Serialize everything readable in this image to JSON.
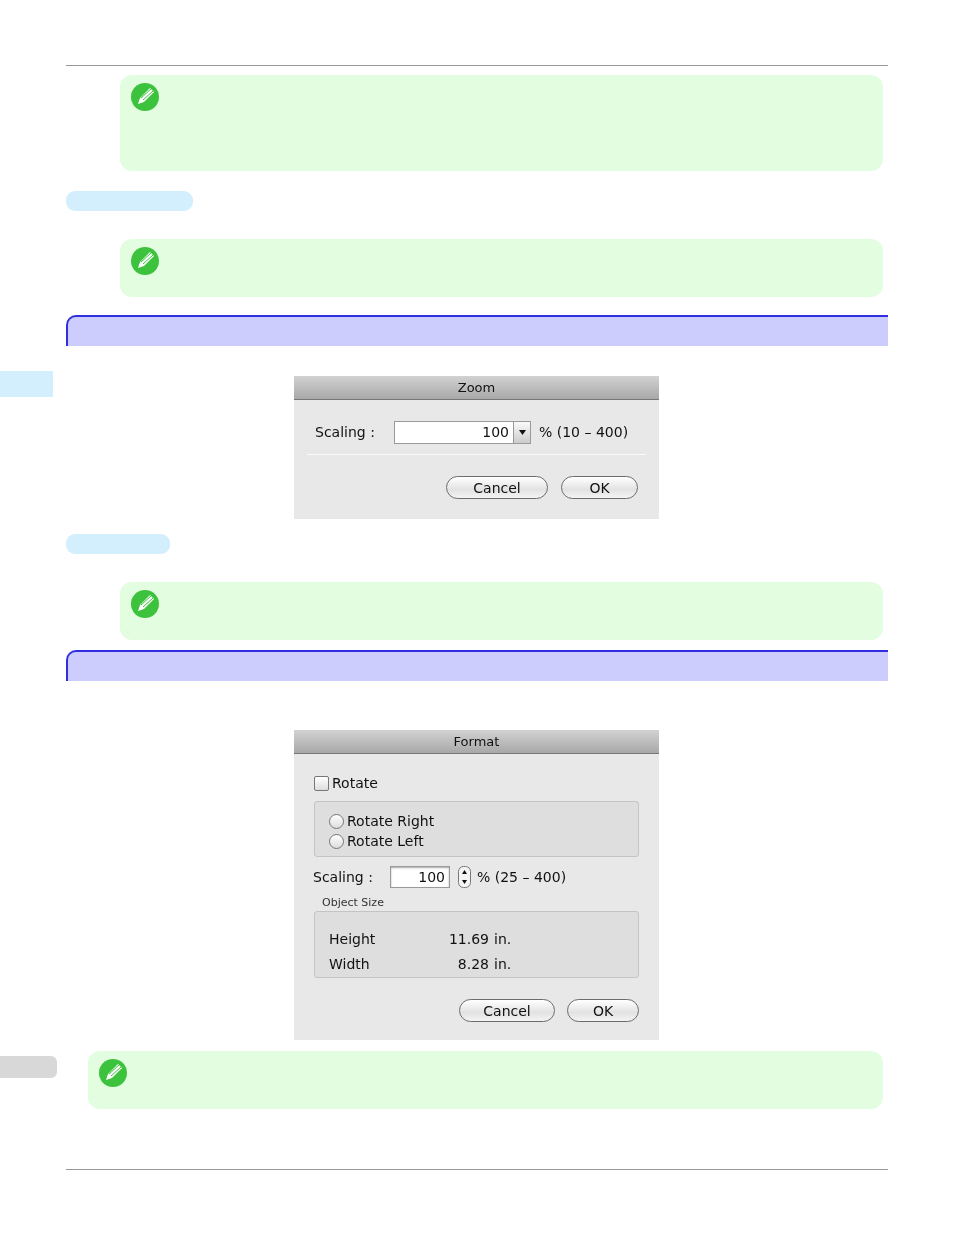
{
  "blocks": [
    {
      "kind": "rule"
    },
    {
      "kind": "note"
    },
    {
      "kind": "pill"
    },
    {
      "kind": "note"
    },
    {
      "kind": "heading"
    },
    {
      "kind": "zoom_dialog",
      "title": "Zoom",
      "scaling_label": "Scaling :",
      "value": "100",
      "range": "% (10 – 400)",
      "buttons": [
        "Cancel",
        "OK"
      ]
    },
    {
      "kind": "pill"
    },
    {
      "kind": "note"
    },
    {
      "kind": "heading"
    },
    {
      "kind": "format_dialog",
      "title": "Format",
      "rotate": {
        "label": "Rotate",
        "checked": false
      },
      "radios": [
        {
          "label": "Rotate Right",
          "selected": false
        },
        {
          "label": "Rotate Left",
          "selected": false
        }
      ],
      "scaling_label": "Scaling :",
      "value": "100",
      "range": "% (25 – 400)",
      "object_size": {
        "legend": "Object Size",
        "rows": [
          {
            "label": "Height",
            "value": "11.69",
            "unit": "in."
          },
          {
            "label": "Width",
            "value": "8.28",
            "unit": "in."
          }
        ]
      },
      "buttons": [
        "Cancel",
        "OK"
      ]
    },
    {
      "kind": "note"
    },
    {
      "kind": "rule"
    }
  ]
}
